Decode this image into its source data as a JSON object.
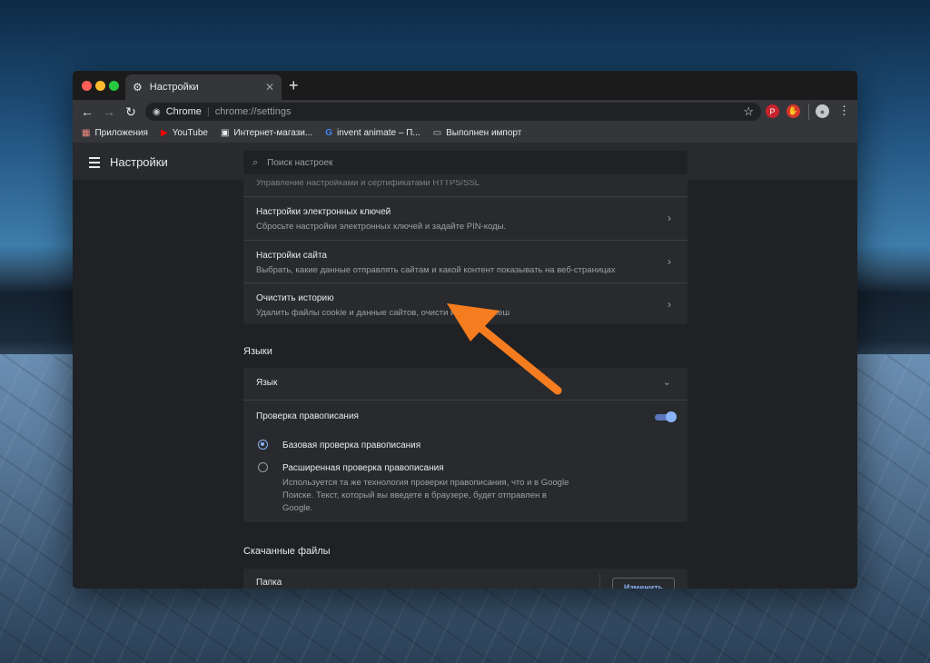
{
  "tab": {
    "title": "Настройки",
    "close": "✕",
    "new": "+"
  },
  "toolbar": {
    "back": "←",
    "forward": "→",
    "reload": "↻",
    "site_name": "Chrome",
    "url": "chrome://settings",
    "star": "☆",
    "menu": "⋮"
  },
  "bookmarks": [
    {
      "label": "Приложения",
      "icon": "apps-grid-icon"
    },
    {
      "label": "YouTube",
      "icon": "youtube-icon"
    },
    {
      "label": "Интернет-магази...",
      "icon": "shop-icon"
    },
    {
      "label": "invent animate – П...",
      "icon": "google-icon"
    },
    {
      "label": "Выполнен импорт",
      "icon": "folder-icon"
    }
  ],
  "header": {
    "title": "Настройки",
    "search_placeholder": "Поиск настроек"
  },
  "privacy": {
    "partial_row": "Управление настройками и сертификатами HTTPS/SSL",
    "rows": [
      {
        "title": "Настройки электронных ключей",
        "subtitle": "Сбросьте настройки электронных ключей и задайте PIN-коды."
      },
      {
        "title": "Настройки сайта",
        "subtitle": "Выбрать, какие данные отправлять сайтам и какой контент показывать на веб-страницах"
      },
      {
        "title": "Очистить историю",
        "subtitle": "Удалить файлы cookie и данные сайтов, очисти   историю и кеш"
      }
    ]
  },
  "languages": {
    "section": "Языки",
    "language_row": "Язык",
    "spellcheck": "Проверка правописания",
    "spellcheck_enabled": true,
    "basic": "Базовая проверка правописания",
    "enhanced": "Расширенная проверка правописания",
    "enhanced_desc_1": "Используется та же технология проверки правописания, что и в Google",
    "enhanced_desc_2": "Поиске. Текст, который вы введете в браузере, будет отправлен в",
    "enhanced_desc_3": "Google."
  },
  "downloads": {
    "section": "Скачанные файлы",
    "folder": "Папка",
    "change_button": "Изменить"
  },
  "colors": {
    "accent": "#8ab4f8",
    "arrow": "#f57c1f"
  }
}
